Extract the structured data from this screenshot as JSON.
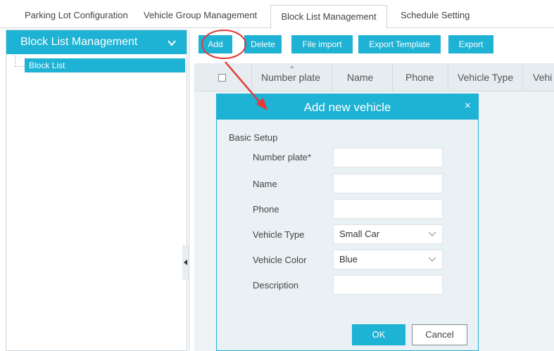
{
  "tabs": [
    {
      "label": "Parking Lot Configuration"
    },
    {
      "label": "Vehicle Group Management"
    },
    {
      "label": "Block List Management"
    },
    {
      "label": "Schedule Setting"
    }
  ],
  "sidebar": {
    "title": "Block List Management",
    "item": "Block List"
  },
  "toolbar": {
    "add": "Add",
    "delete": "Delete",
    "file_import": "File import",
    "export_template": "Export Template",
    "export": "Export"
  },
  "grid": {
    "columns": [
      "Number plate",
      "Name",
      "Phone",
      "Vehicle Type",
      "Vehi"
    ]
  },
  "dialog": {
    "title": "Add new vehicle",
    "close": "×",
    "section": "Basic Setup",
    "fields": {
      "number_plate": {
        "label": "Number plate*",
        "value": ""
      },
      "name": {
        "label": "Name",
        "value": ""
      },
      "phone": {
        "label": "Phone",
        "value": ""
      },
      "vehicle_type": {
        "label": "Vehicle Type",
        "value": "Small Car"
      },
      "vehicle_color": {
        "label": "Vehicle Color",
        "value": "Blue"
      },
      "description": {
        "label": "Description",
        "value": ""
      }
    },
    "ok": "OK",
    "cancel": "Cancel"
  },
  "colors": {
    "accent": "#1eb2d4",
    "annotation": "#e53935"
  },
  "icons": {
    "sidebar_toggle": "chevron-down-icon",
    "dialog_close": "close-icon",
    "select": "chevron-down-icon",
    "splitter": "collapse-left-icon"
  }
}
